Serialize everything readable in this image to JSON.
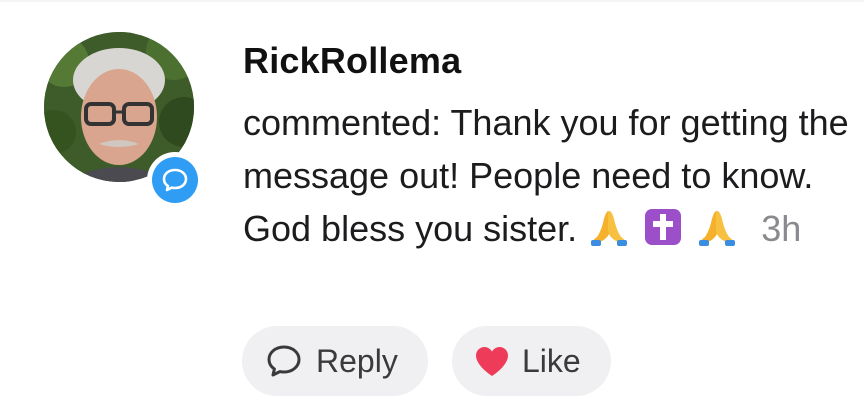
{
  "comment": {
    "username": "RickRollema",
    "text": "commented: Thank you for getting the message out! People need to know. God bless you sister.",
    "emojis": [
      "folded-hands",
      "latin-cross",
      "folded-hands"
    ],
    "timestamp": "3h"
  },
  "actions": {
    "reply_label": "Reply",
    "like_label": "Like"
  },
  "colors": {
    "badge": "#2f9df4",
    "heart": "#ef3b5a",
    "button_bg": "#f0f0f2",
    "timestamp": "#8a8a8e"
  }
}
